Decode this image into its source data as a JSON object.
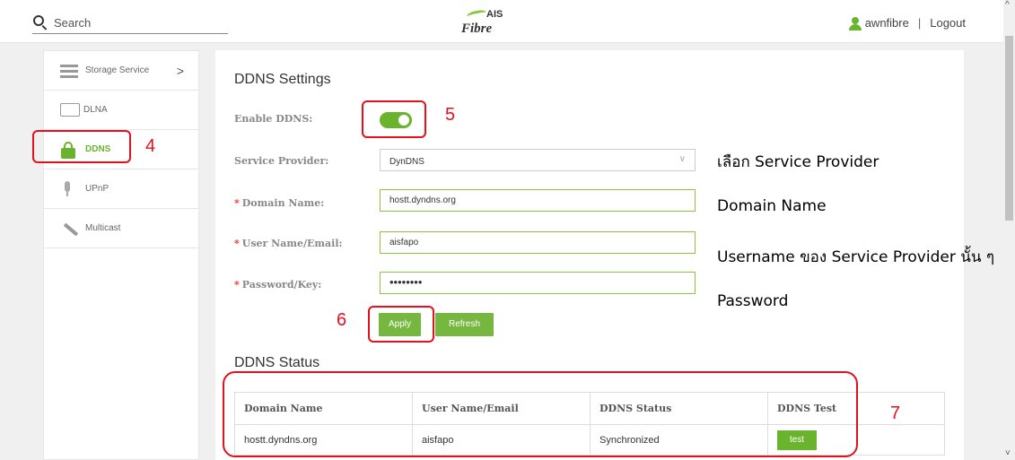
{
  "header": {
    "search_label": "Search",
    "logo_top": "AIS",
    "logo_bottom": "Fibre",
    "username": "awnfibre",
    "separator": "|",
    "logout": "Logout"
  },
  "scrollbar": {
    "up": "^",
    "down": "˅"
  },
  "sidebar": {
    "items": [
      {
        "label": "Storage Service",
        "chevron": ">"
      },
      {
        "label": "DLNA"
      },
      {
        "label": "DDNS"
      },
      {
        "label": "UPnP"
      },
      {
        "label": "Multicast"
      }
    ]
  },
  "ddns": {
    "title": "DDNS Settings",
    "enable_label": "Enable DDNS:",
    "enable_value": true,
    "provider_label": "Service Provider:",
    "provider_value": "DynDNS",
    "domain_label": "Domain Name:",
    "domain_value": "hostt.dyndns.org",
    "user_label": "User Name/Email:",
    "user_value": "aisfapo",
    "password_label": "Password/Key:",
    "password_value": "••••••••",
    "required_mark": "*",
    "apply": "Apply",
    "refresh": "Refresh"
  },
  "status": {
    "title": "DDNS Status",
    "columns": [
      "Domain Name",
      "User Name/Email",
      "DDNS Status",
      "DDNS Test"
    ],
    "row": {
      "domain": "hostt.dyndns.org",
      "user": "aisfapo",
      "status": "Synchronized",
      "test": "test"
    }
  },
  "annotations": {
    "n4": "4",
    "n5": "5",
    "n6": "6",
    "n7": "7",
    "note_provider": "เลือก Service Provider",
    "note_domain": "Domain Name",
    "note_username": "Username ของ Service Provider นั้น ๆ",
    "note_password": "Password"
  },
  "colors": {
    "accent": "#6ab42d",
    "annotation": "#e3101e"
  }
}
